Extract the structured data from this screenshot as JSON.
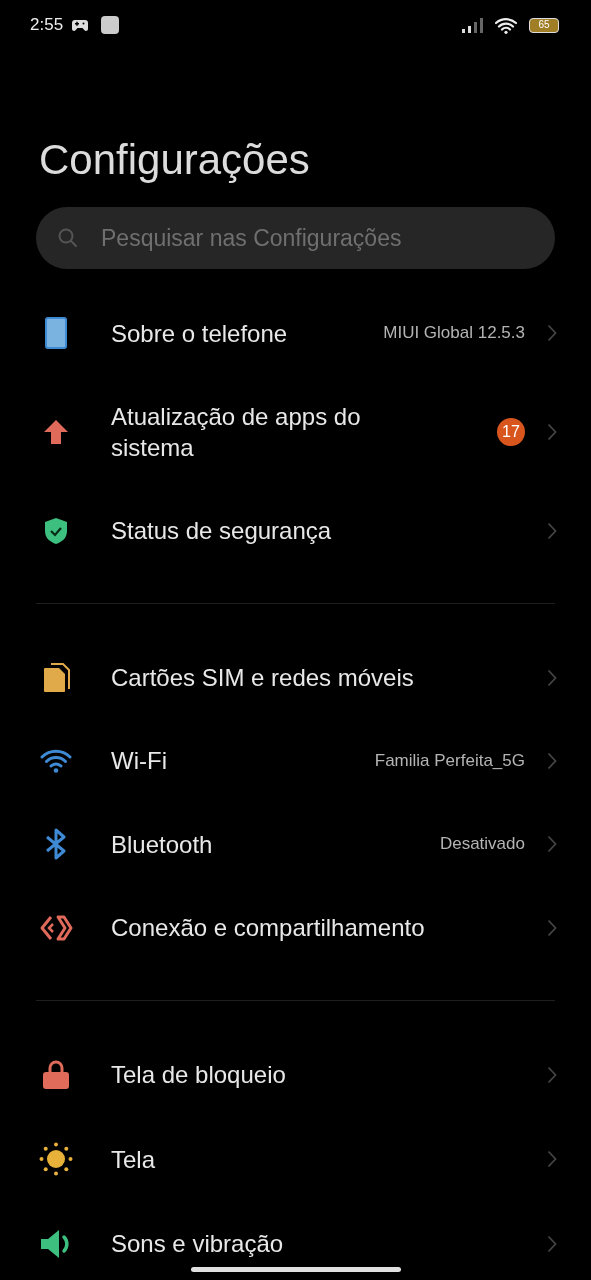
{
  "status_bar": {
    "time": "2:55",
    "battery_text": "65"
  },
  "title": "Configurações",
  "search": {
    "placeholder": "Pesquisar nas Configurações"
  },
  "groups": [
    {
      "items": [
        {
          "kind": "phone",
          "label": "Sobre o telefone",
          "value": "MIUI Global 12.5.3"
        },
        {
          "kind": "update",
          "label": "Atualização de apps do sistema",
          "badge": "17"
        },
        {
          "kind": "shield",
          "label": "Status de segurança"
        }
      ]
    },
    {
      "items": [
        {
          "kind": "sim",
          "label": "Cartões SIM e redes móveis"
        },
        {
          "kind": "wifi",
          "label": "Wi-Fi",
          "value": "Familia Perfeita_5G"
        },
        {
          "kind": "bluetooth",
          "label": "Bluetooth",
          "value": "Desativado"
        },
        {
          "kind": "share",
          "label": "Conexão e compartilhamento"
        }
      ]
    },
    {
      "items": [
        {
          "kind": "lock",
          "label": "Tela de bloqueio"
        },
        {
          "kind": "sun",
          "label": "Tela"
        },
        {
          "kind": "sound",
          "label": "Sons e vibração"
        }
      ]
    }
  ]
}
